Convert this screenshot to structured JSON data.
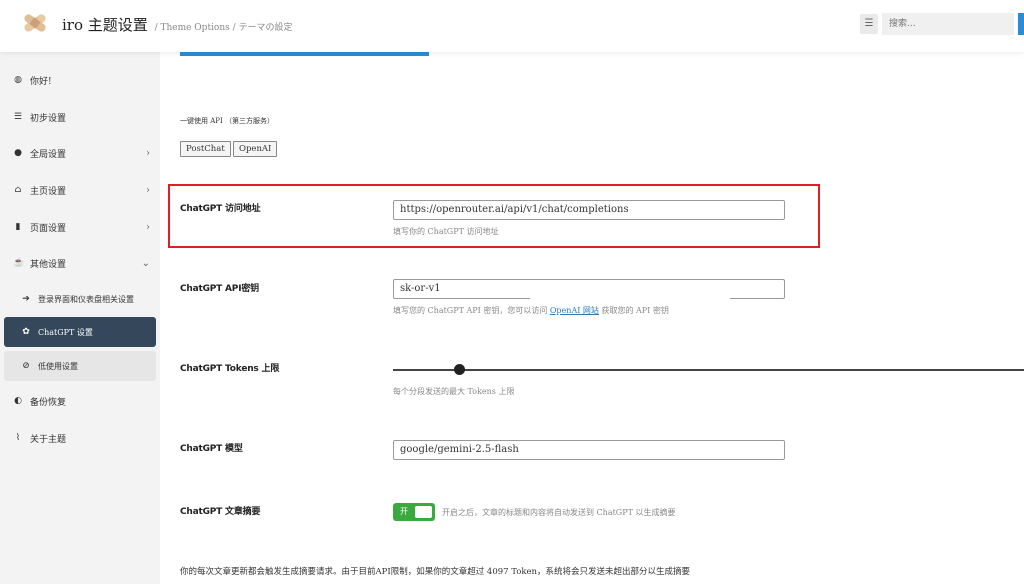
{
  "header": {
    "title": "iro 主题设置",
    "subtitle": "/ Theme Options / テーマの設定",
    "search_placeholder": "搜索..."
  },
  "sidebar": {
    "items": [
      {
        "label": "你好!",
        "icon": "globe-icon"
      },
      {
        "label": "初步设置",
        "icon": "sliders-icon"
      },
      {
        "label": "全局设置",
        "icon": "globe-icon",
        "chevron": "›"
      },
      {
        "label": "主页设置",
        "icon": "home-icon",
        "chevron": "›"
      },
      {
        "label": "页面设置",
        "icon": "file-icon",
        "chevron": "›"
      },
      {
        "label": "其他设置",
        "icon": "coffee-icon",
        "chevron": "⌄"
      },
      {
        "label": "登录界面和仪表盘相关设置",
        "icon": "sign-in-icon"
      },
      {
        "label": "ChatGPT 设置",
        "icon": "openai-icon"
      },
      {
        "label": "低使用设置",
        "icon": "eye-slash-icon"
      },
      {
        "label": "备份恢复",
        "icon": "shield-icon"
      },
      {
        "label": "关于主题",
        "icon": "paperclip-icon"
      }
    ]
  },
  "main": {
    "section_title": "一键使用 API （第三方服务）",
    "buttons": [
      "PostChat",
      "OpenAI"
    ],
    "fields": {
      "url_label": "ChatGPT 访问地址",
      "url_value": "https://openrouter.ai/api/v1/chat/completions",
      "url_help": "填写你的 ChatGPT 访问地址",
      "key_label": "ChatGPT API密钥",
      "key_value": "sk-or-v1",
      "key_help_pre": "填写您的 ChatGPT API 密钥，您可以访问",
      "key_help_link": "OpenAI 网站",
      "key_help_post": "获取您的 API 密钥",
      "tokens_label": "ChatGPT Tokens 上限",
      "tokens_help": "每个分段发送的最大 Tokens 上限",
      "tokens_fraction": 0.11,
      "model_label": "ChatGPT 模型",
      "model_value": "google/gemini-2.5-flash",
      "summary_label": "ChatGPT 文章摘要",
      "toggle_text": "开",
      "summary_help": "开启之后，文章的标题和内容将自动发送到 ChatGPT 以生成摘要"
    },
    "footer": "你的每次文章更新都会触发生成摘要请求。由于目前API限制，如果你的文章超过 4097 Token，系统将会只发送未超出部分以生成摘要"
  },
  "colors": {
    "accent": "#2a8cd6",
    "active_sidebar": "#35475a",
    "toggle_on": "#3aaa3e",
    "highlight": "#e02020"
  }
}
